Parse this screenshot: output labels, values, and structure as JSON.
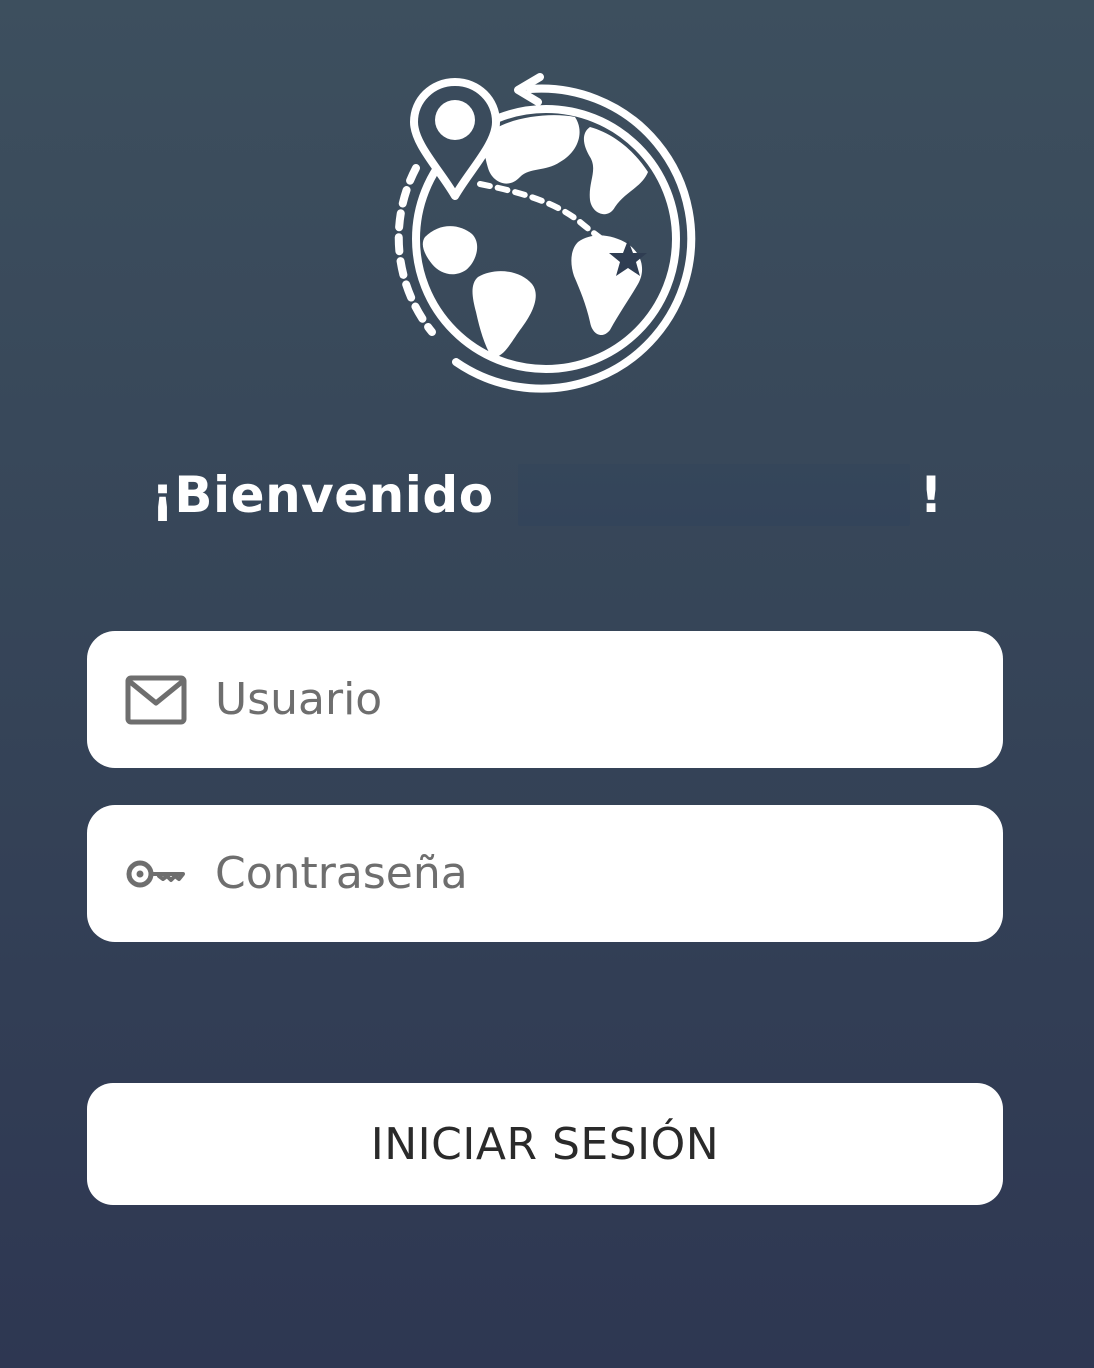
{
  "header": {
    "logo_icon": "globe-location-icon"
  },
  "welcome": {
    "prefix": "¡Bienvenido",
    "suffix": "!"
  },
  "form": {
    "username": {
      "placeholder": "Usuario",
      "value": "",
      "icon": "envelope-icon"
    },
    "password": {
      "placeholder": "Contraseña",
      "value": "",
      "icon": "key-icon"
    },
    "submit_label": "INICIAR SESIÓN"
  },
  "colors": {
    "background_top": "#3d4f5e",
    "background_bottom": "#2e3752",
    "field_bg": "#ffffff",
    "icon_color": "#6e6e6e",
    "text_white": "#ffffff"
  }
}
